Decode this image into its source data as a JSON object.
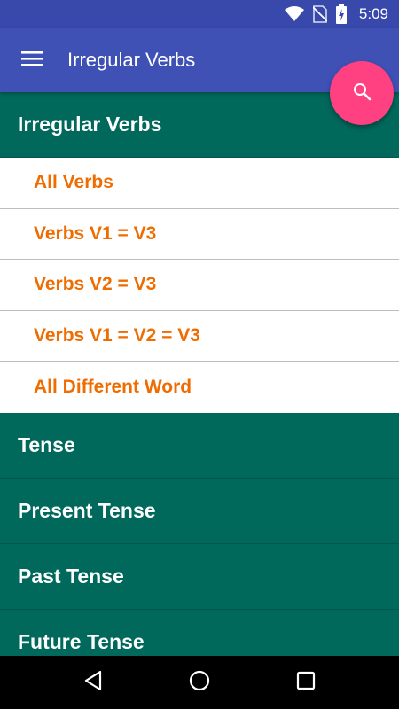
{
  "status_bar": {
    "time": "5:09",
    "icons": [
      "wifi-icon",
      "no-sim-icon",
      "battery-charging-icon"
    ]
  },
  "app_bar": {
    "title": "Irregular Verbs",
    "menu_icon": "hamburger-menu-icon",
    "background": "#3f51b5"
  },
  "fab": {
    "icon": "search-icon",
    "color": "#ff4081"
  },
  "list": {
    "header_color": "#00695c",
    "sub_item_color": "#ef6c00",
    "sections": [
      {
        "label": "Irregular Verbs",
        "items": [
          "All Verbs",
          "Verbs V1 = V3",
          "Verbs V2 = V3",
          "Verbs V1 = V2 = V3",
          "All Different Word"
        ]
      },
      {
        "label": "Tense"
      },
      {
        "label": "Present Tense"
      },
      {
        "label": "Past Tense"
      },
      {
        "label": "Future Tense"
      }
    ]
  },
  "nav_bar": {
    "buttons": [
      "back-icon",
      "home-icon",
      "recents-icon"
    ]
  }
}
